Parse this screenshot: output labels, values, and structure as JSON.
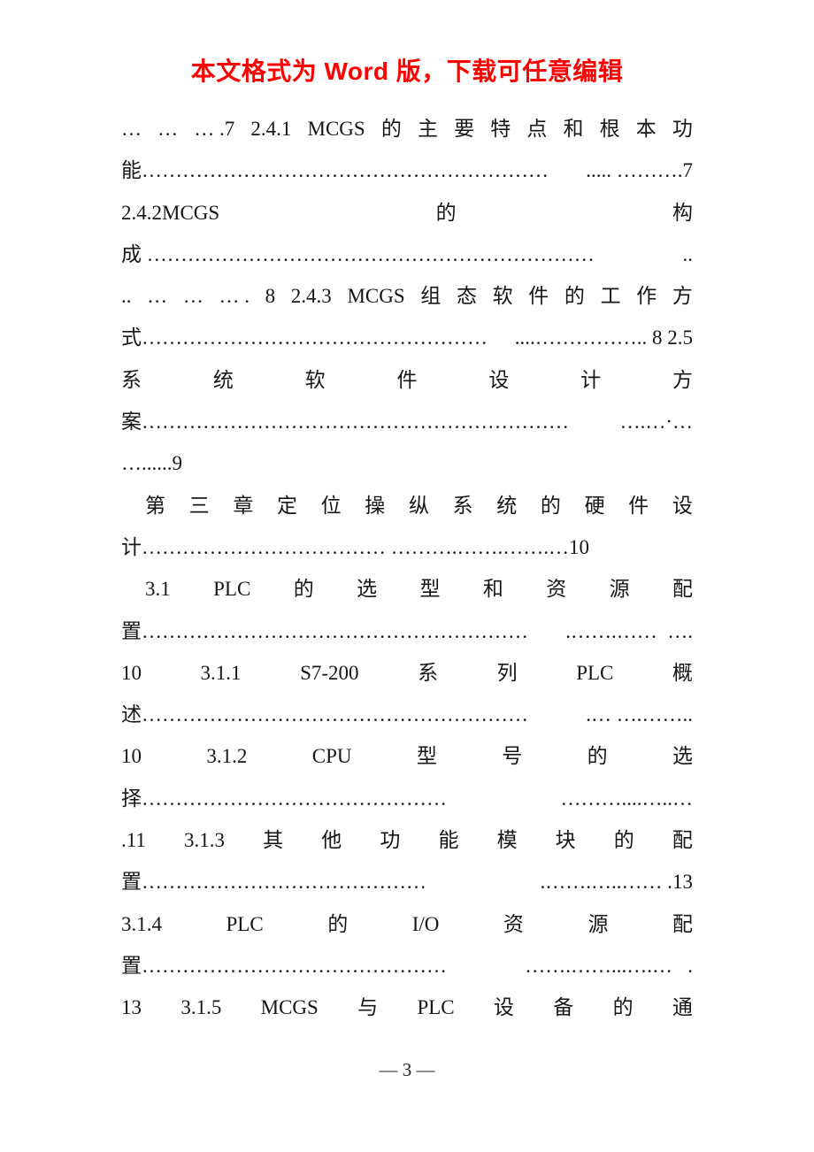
{
  "document": {
    "page_number_label": "— 3 —",
    "promo_banner": {
      "text": "本文格式为 Word 版，下载可任意编辑",
      "color": "#ff0000"
    }
  },
  "toc": {
    "lines": [
      {
        "id": "l1",
        "kind": "justified",
        "indent": false,
        "segments": [
          "…",
          "…",
          "… .7",
          "2.4.1",
          "MCGS",
          "的",
          "主",
          "要",
          "特",
          "点",
          "和",
          "根",
          "本",
          "功"
        ]
      },
      {
        "id": "l2",
        "kind": "leader",
        "head": "能",
        "leader": "……………………………………………………",
        "tail": "..... ……….7"
      },
      {
        "id": "l3",
        "kind": "justified",
        "indent": false,
        "segments": [
          "2.4.2MCGS",
          "的",
          "构"
        ]
      },
      {
        "id": "l4",
        "kind": "leader",
        "head": "成 ",
        "leader": "…………………………………………………………",
        "tail": ".."
      },
      {
        "id": "l5",
        "kind": "justified",
        "indent": false,
        "segments": [
          "..",
          "…",
          "…",
          "… .",
          "8",
          "2.4.3",
          "MCGS",
          "组",
          "态",
          "软",
          "件",
          "的",
          "工",
          "作",
          "方"
        ]
      },
      {
        "id": "l6",
        "kind": "leader",
        "head": "式",
        "leader": "……………………………………………",
        "tail": "....…………….. 8 2.5"
      },
      {
        "id": "l7",
        "kind": "justified",
        "indent": false,
        "segments": [
          "系",
          "统",
          "软",
          "件",
          "设",
          "计",
          "方"
        ]
      },
      {
        "id": "l8",
        "kind": "leader",
        "head": "案",
        "leader": "………………………………………………………",
        "tail": " ….…·…"
      },
      {
        "id": "l9",
        "kind": "flow",
        "text": "…......9"
      },
      {
        "id": "l10",
        "kind": "justified",
        "indent": true,
        "segments": [
          "第",
          "三",
          "章",
          "定",
          "位",
          "操",
          "纵",
          "系",
          "统",
          "的",
          "硬",
          "件",
          "设"
        ]
      },
      {
        "id": "l11",
        "kind": "flow",
        "text": "计……………………………… ……….…….…….…10"
      },
      {
        "id": "l12",
        "kind": "justified",
        "indent": true,
        "segments": [
          "3.1",
          "PLC",
          "的",
          "选",
          "型",
          "和",
          "资",
          "源",
          "配"
        ]
      },
      {
        "id": "l13",
        "kind": "leader",
        "head": "置",
        "leader": "…………………………………………………",
        "tail": ".…….……  …."
      },
      {
        "id": "l14",
        "kind": "justified",
        "indent": false,
        "segments": [
          "10",
          "3.1.1",
          "S7-200",
          "系",
          "列",
          "PLC",
          "概"
        ]
      },
      {
        "id": "l15",
        "kind": "leader",
        "head": "述",
        "leader": "…………………………………………………",
        "tail": ".… ….…….."
      },
      {
        "id": "l16",
        "kind": "justified",
        "indent": false,
        "segments": [
          "10",
          "3.1.2",
          "CPU",
          "型",
          "号",
          "的",
          "选"
        ]
      },
      {
        "id": "l17",
        "kind": "leader",
        "head": "择",
        "leader": "………………………………………",
        "tail": " ………....…..…"
      },
      {
        "id": "l18",
        "kind": "justified",
        "indent": false,
        "segments": [
          ".11",
          "3.1.3",
          "其",
          "他",
          "功",
          "能",
          "模",
          "块",
          "的",
          "配"
        ]
      },
      {
        "id": "l19",
        "kind": "leader",
        "head": "置",
        "leader": "……………………………………",
        "tail": ".…….…..…… .13"
      },
      {
        "id": "l20",
        "kind": "justified",
        "indent": false,
        "segments": [
          "3.1.4",
          "PLC",
          "的",
          "I/O",
          "资",
          "源",
          "配"
        ]
      },
      {
        "id": "l21",
        "kind": "leader",
        "head": "置",
        "leader": "………………………………………",
        "tail": " …….……...….…   ."
      },
      {
        "id": "l22",
        "kind": "justified",
        "indent": false,
        "segments": [
          "13",
          "3.1.5",
          "MCGS",
          "与",
          "PLC",
          "设",
          "备",
          "的",
          "通"
        ]
      }
    ]
  }
}
